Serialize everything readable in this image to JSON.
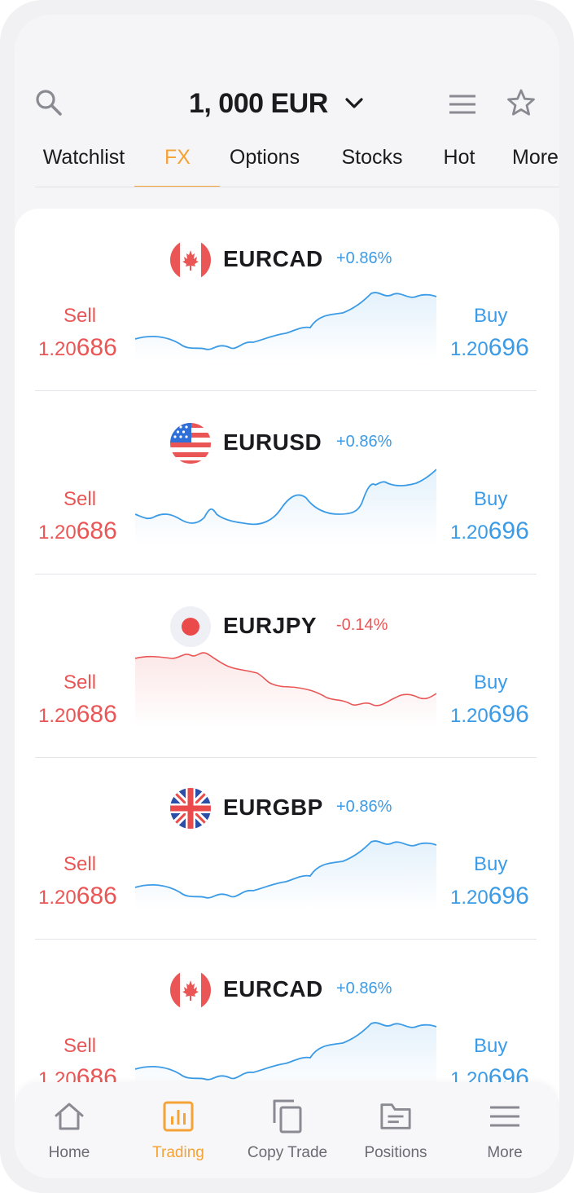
{
  "header": {
    "balance": "1, 000 EUR"
  },
  "tabs": [
    {
      "label": "Watchlist",
      "active": false
    },
    {
      "label": "FX",
      "active": true
    },
    {
      "label": "Options",
      "active": false
    },
    {
      "label": "Stocks",
      "active": false
    },
    {
      "label": "Hot",
      "active": false
    },
    {
      "label": "More",
      "active": false
    }
  ],
  "pairs": [
    {
      "symbol": "EURCAD",
      "change": "+0.86%",
      "direction": "up",
      "flag": "canada-flag-icon",
      "sell_label": "Sell",
      "sell_price_prefix": "1.20",
      "sell_price_big": "686",
      "buy_label": "Buy",
      "buy_price_prefix": "1.20",
      "buy_price_big": "696"
    },
    {
      "symbol": "EURUSD",
      "change": "+0.86%",
      "direction": "up",
      "flag": "usa-flag-icon",
      "sell_label": "Sell",
      "sell_price_prefix": "1.20",
      "sell_price_big": "686",
      "buy_label": "Buy",
      "buy_price_prefix": "1.20",
      "buy_price_big": "696"
    },
    {
      "symbol": "EURJPY",
      "change": "-0.14%",
      "direction": "down",
      "flag": "japan-flag-icon",
      "sell_label": "Sell",
      "sell_price_prefix": "1.20",
      "sell_price_big": "686",
      "buy_label": "Buy",
      "buy_price_prefix": "1.20",
      "buy_price_big": "696"
    },
    {
      "symbol": "EURGBP",
      "change": "+0.86%",
      "direction": "up",
      "flag": "uk-flag-icon",
      "sell_label": "Sell",
      "sell_price_prefix": "1.20",
      "sell_price_big": "686",
      "buy_label": "Buy",
      "buy_price_prefix": "1.20",
      "buy_price_big": "696"
    },
    {
      "symbol": "EURCAD",
      "change": "+0.86%",
      "direction": "up",
      "flag": "canada-flag-icon",
      "sell_label": "Sell",
      "sell_price_prefix": "1.20",
      "sell_price_big": "686",
      "buy_label": "Buy",
      "buy_price_prefix": "1.20",
      "buy_price_big": "696"
    }
  ],
  "bottom_nav": [
    {
      "label": "Home",
      "icon": "home-icon",
      "active": false
    },
    {
      "label": "Trading",
      "icon": "trading-chart-icon",
      "active": true
    },
    {
      "label": "Copy Trade",
      "icon": "copy-icon",
      "active": false
    },
    {
      "label": "Positions",
      "icon": "folder-icon",
      "active": false
    },
    {
      "label": "More",
      "icon": "menu-icon",
      "active": false
    }
  ],
  "colors": {
    "accent": "#f5a236",
    "up": "#3b9be6",
    "down": "#ea5656",
    "text": "#1b1b1f",
    "muted": "#6b6b73"
  }
}
